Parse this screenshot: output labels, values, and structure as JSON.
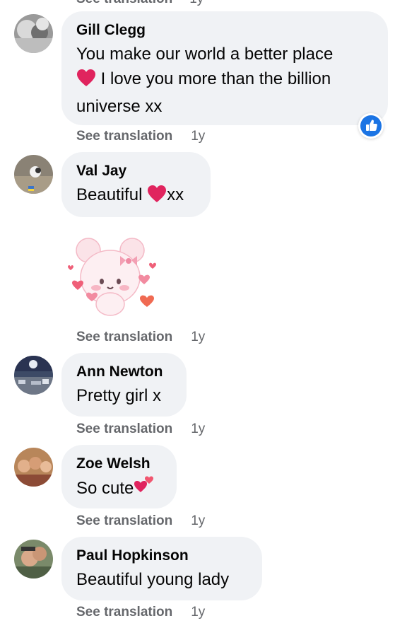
{
  "top_cut": {
    "see_label": "See translation",
    "age": "1y"
  },
  "comments": [
    {
      "author": "Gill Clegg",
      "text_before": "You make our world a better place",
      "text_after": " I love you more than the billion universe xx",
      "age": "1y",
      "see_label": "See translation",
      "reaction": "like-icon"
    },
    {
      "author": "Val Jay",
      "text_before": "Beautiful ",
      "text_after": "xx",
      "sticker": "bear-sticker",
      "age": "1y",
      "see_label": "See translation"
    },
    {
      "author": "Ann Newton",
      "text": "Pretty girl x",
      "age": "1y",
      "see_label": "See translation"
    },
    {
      "author": "Zoe Welsh",
      "text": "So cute",
      "age": "1y",
      "see_label": "See translation"
    },
    {
      "author": "Paul Hopkinson",
      "text": "Beautiful young lady",
      "age": "1y",
      "see_label": "See translation"
    }
  ],
  "colors": {
    "bubble": "#f0f2f5",
    "meta": "#65676b",
    "like_blue": "#1b74e4",
    "heart": "#e0245e"
  }
}
